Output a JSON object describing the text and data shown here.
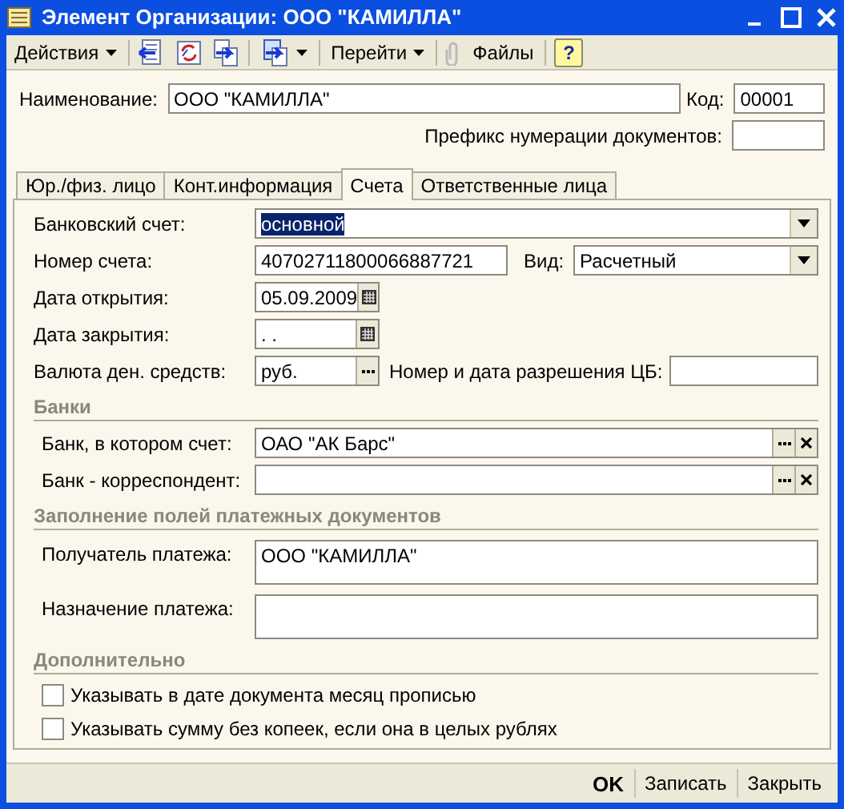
{
  "window": {
    "title": "Элемент Организации: ООО \"КАМИЛЛА\""
  },
  "toolbar": {
    "actions_menu": "Действия",
    "goto_menu": "Перейти",
    "files_button": "Файлы",
    "help_button": "?"
  },
  "header": {
    "name": {
      "label": "Наименование:",
      "value": "ООО \"КАМИЛЛА\""
    },
    "code": {
      "label": "Код:",
      "value": "00001"
    },
    "prefix": {
      "label": "Префикс нумерации документов:"
    }
  },
  "tabs": [
    {
      "label": "Юр./физ. лицо",
      "selected": false
    },
    {
      "label": "Конт.информация",
      "selected": false
    },
    {
      "label": "Счета",
      "selected": true
    },
    {
      "label": "Ответственные лица",
      "selected": false
    }
  ],
  "account": {
    "bank_account": {
      "label": "Банковский счет:",
      "value": "основной",
      "text_selected": true
    },
    "number": {
      "label": "Номер счета:",
      "value": "40702711800066887721"
    },
    "type": {
      "label": "Вид:",
      "value": "Расчетный"
    },
    "open_date": {
      "label": "Дата открытия:",
      "value": "05.09.2009"
    },
    "close_date": {
      "label": "Дата закрытия:",
      "value": " .  ."
    },
    "currency": {
      "label": "Валюта ден. средств:",
      "value": "руб."
    },
    "cb_permit": {
      "label": "Номер и дата разрешения ЦБ:"
    }
  },
  "banks": {
    "title": "Банки",
    "fields": [
      {
        "label": "Банк, в котором счет:",
        "value": "ОАО \"АК Барс\""
      },
      {
        "label": "Банк - корреспондент:"
      }
    ]
  },
  "payment": {
    "title": "Заполнение полей платежных документов",
    "fields": [
      {
        "label": "Получатель платежа:",
        "value": "ООО \"КАМИЛЛА\""
      },
      {
        "label": "Назначение платежа:"
      }
    ]
  },
  "extra": {
    "title": "Дополнительно",
    "options": [
      {
        "label": "Указывать в дате документа месяц прописью",
        "checked": false
      },
      {
        "label": "Указывать сумму без копеек, если она в целых рублях",
        "checked": false
      }
    ]
  },
  "buttons": [
    {
      "label": "OK",
      "kind": "default"
    },
    {
      "label": "Записать",
      "kind": "normal"
    },
    {
      "label": "Закрыть",
      "kind": "normal"
    }
  ]
}
